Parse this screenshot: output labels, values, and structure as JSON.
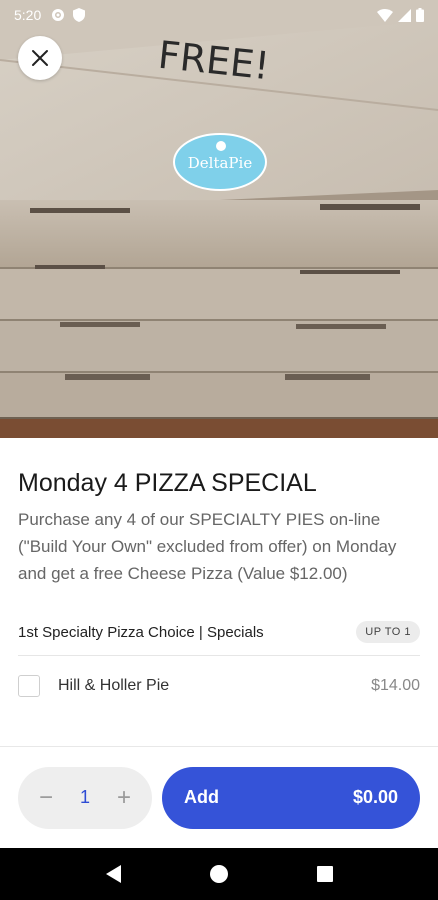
{
  "status_bar": {
    "time": "5:20",
    "icons": [
      "gear-icon",
      "shield-icon",
      "wifi-icon",
      "cell-signal-icon",
      "battery-icon"
    ]
  },
  "hero": {
    "description_icons": [
      "close-icon"
    ],
    "box_text": "FREE!",
    "logo_text": "DeltaPie"
  },
  "item": {
    "title": "Monday 4 PIZZA SPECIAL",
    "description": "Purchase any 4 of our SPECIALTY PIES on-line (\"Build Your Own\" excluded from offer) on Monday and get a free Cheese Pizza (Value $12.00)"
  },
  "option_group": {
    "title": "1st Specialty Pizza Choice | Specials",
    "badge": "UP TO 1",
    "options": [
      {
        "label": "Hill & Holler Pie",
        "price": "$14.00",
        "checked": false
      }
    ]
  },
  "cart": {
    "quantity": "1",
    "minus": "−",
    "plus": "+",
    "add_label": "Add",
    "total": "$0.00"
  },
  "colors": {
    "accent": "#3553d8",
    "quantity_text": "#2d4bd4"
  }
}
